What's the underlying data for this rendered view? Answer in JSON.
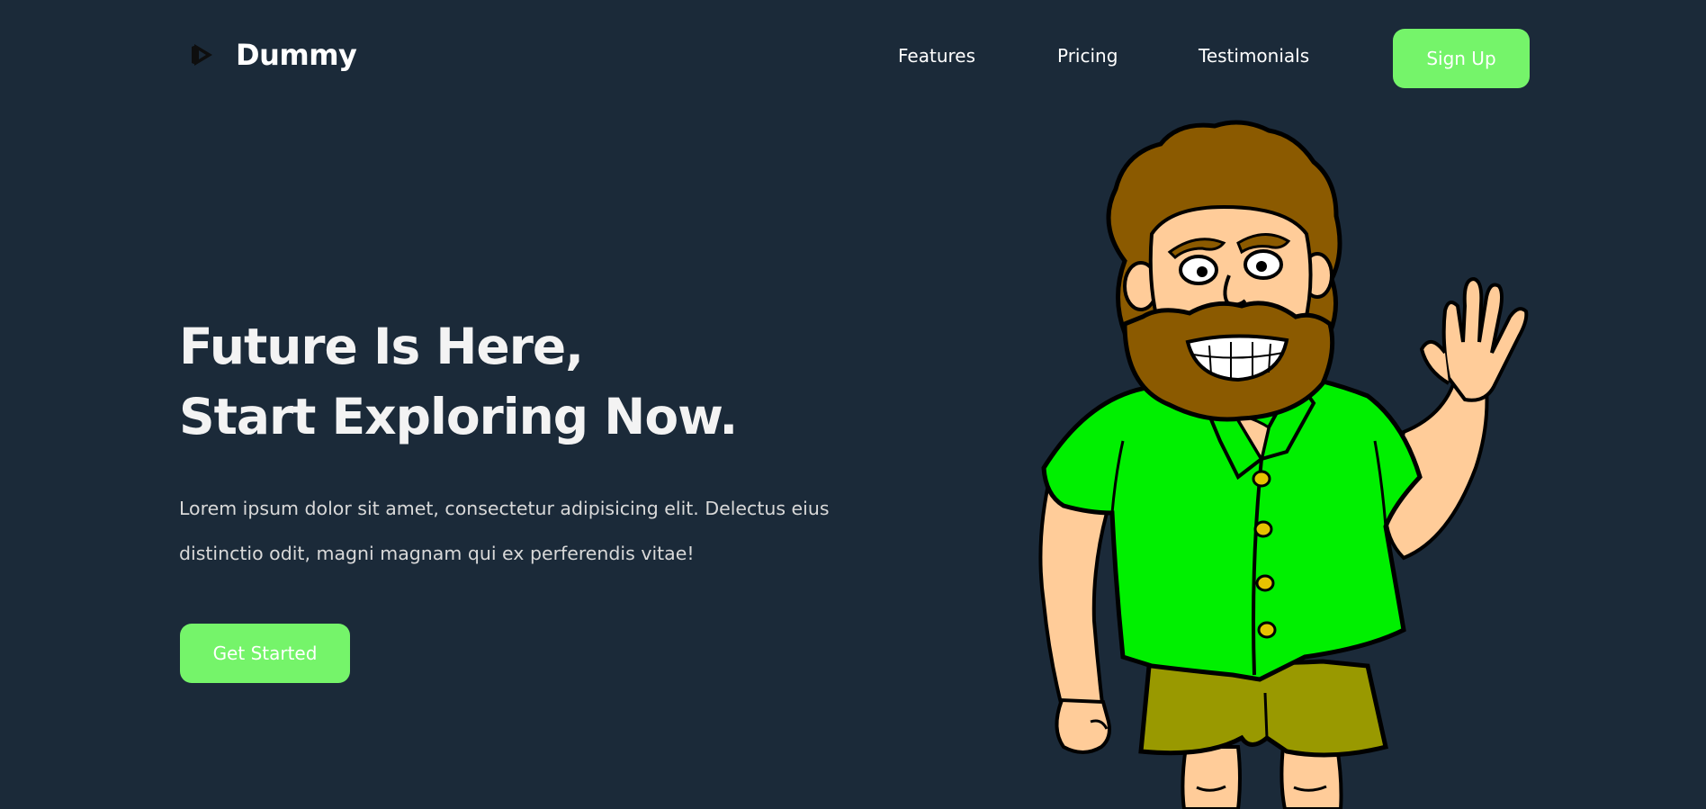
{
  "brand": {
    "name": "Dummy",
    "logo_icon": "play-triangle-icon"
  },
  "nav": {
    "links": [
      "Features",
      "Pricing",
      "Testimonials"
    ],
    "signup_label": "Sign Up"
  },
  "hero": {
    "title_line1": "Future Is Here,",
    "title_line2": "Start Exploring Now.",
    "description": "Lorem ipsum dolor sit amet, consectetur adipisicing elit. Delectus eius distinctio odit, magni magnam qui ex perferendis vitae!",
    "cta_label": "Get Started",
    "illustration": "waving-bearded-man-illustration"
  },
  "colors": {
    "background": "#1b2a39",
    "accent": "#75f46a",
    "heading": "#f3f3f3",
    "body_text": "#d9d9d9",
    "shirt_green": "#00f000",
    "hair_brown": "#8b5a00",
    "shorts_olive": "#999900",
    "skin": "#ffcc99"
  }
}
